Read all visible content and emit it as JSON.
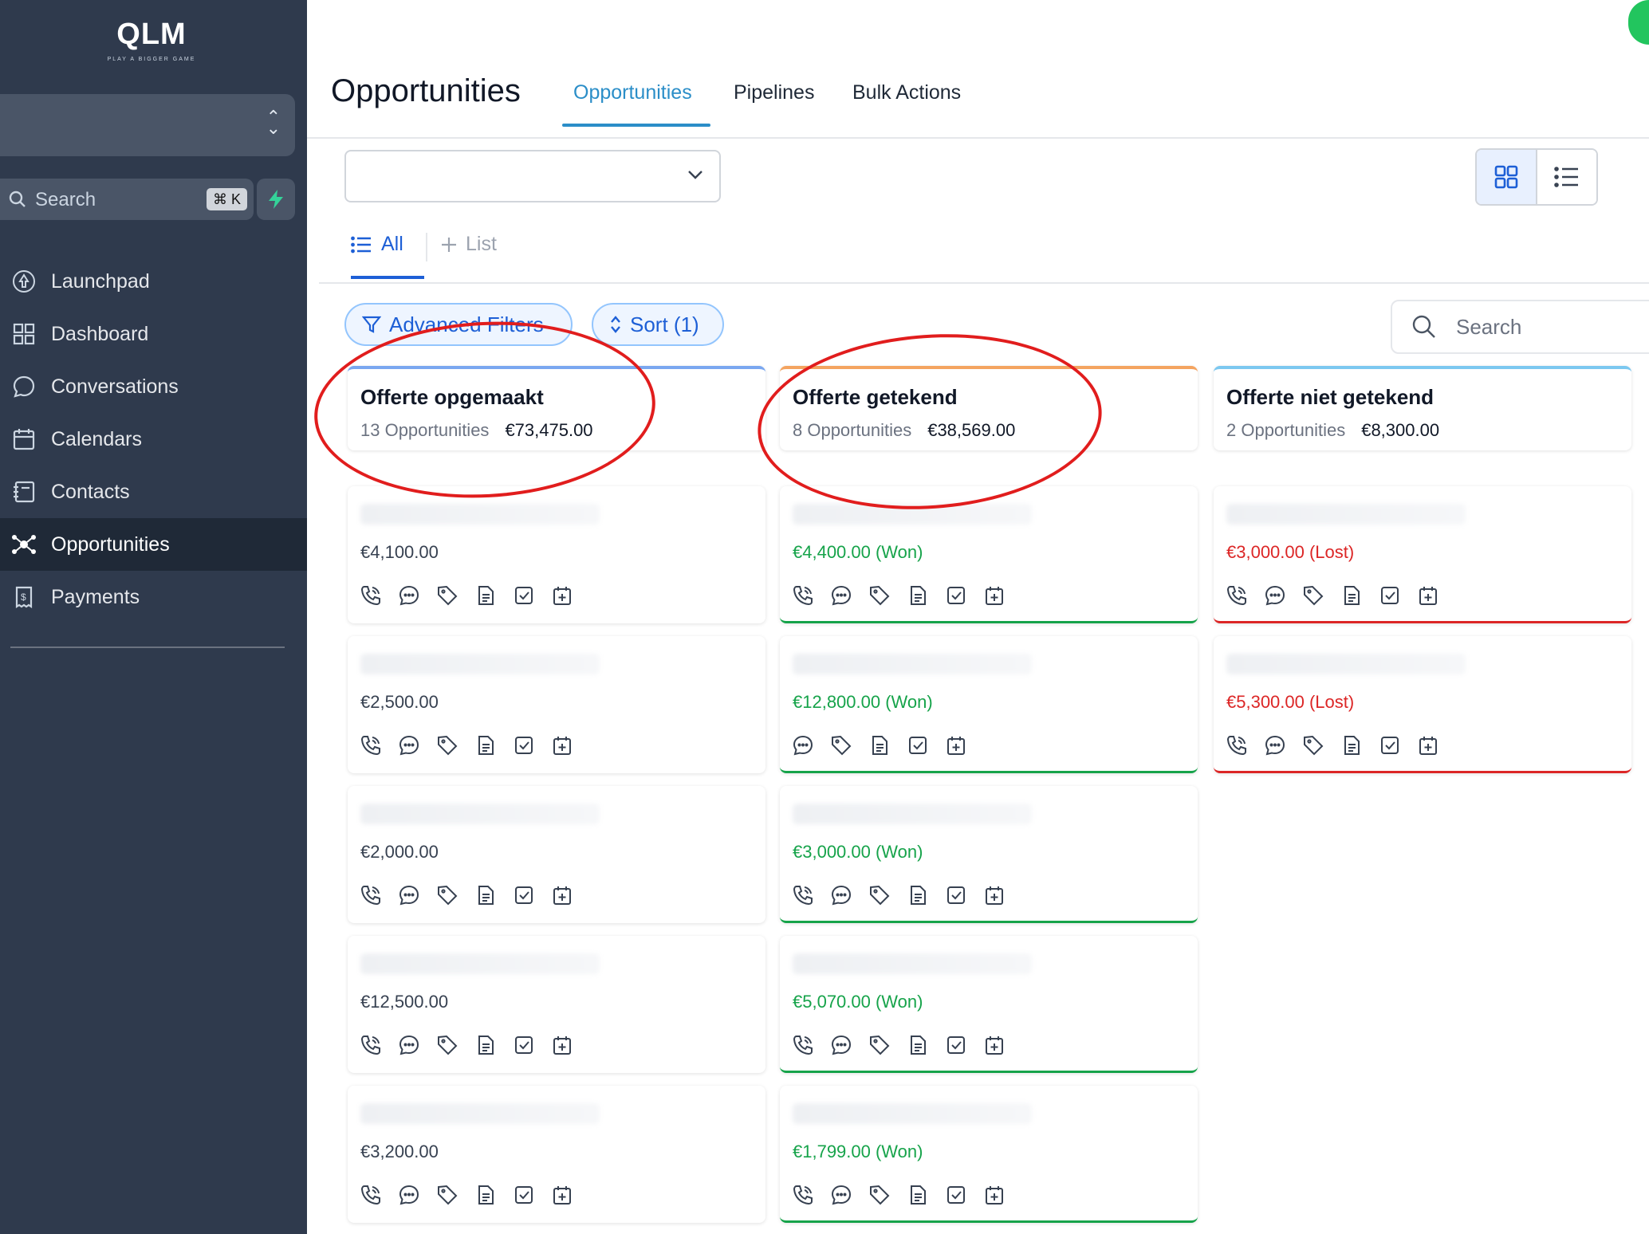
{
  "sidebar": {
    "logo_text": "QLM",
    "logo_tagline": "PLAY A BIGGER GAME",
    "search_placeholder": "Search",
    "search_shortcut": "⌘ K",
    "nav": [
      {
        "label": "Launchpad",
        "icon": "rocket-icon"
      },
      {
        "label": "Dashboard",
        "icon": "dashboard-grid-icon"
      },
      {
        "label": "Conversations",
        "icon": "chat-bubble-icon"
      },
      {
        "label": "Calendars",
        "icon": "calendar-icon"
      },
      {
        "label": "Contacts",
        "icon": "contacts-book-icon"
      },
      {
        "label": "Opportunities",
        "icon": "opportunities-icon",
        "active": true
      },
      {
        "label": "Payments",
        "icon": "payments-icon"
      }
    ]
  },
  "header": {
    "title": "Opportunities",
    "tabs": [
      {
        "label": "Opportunities",
        "active": true
      },
      {
        "label": "Pipelines"
      },
      {
        "label": "Bulk Actions"
      }
    ]
  },
  "toolbar": {
    "pipeline_value": "",
    "subtab_all": "All",
    "subtab_add_list": "List",
    "advanced_filters": "Advanced Filters",
    "sort": "Sort (1)",
    "search_placeholder": "Search"
  },
  "colors": {
    "accent": "#2b8ec8",
    "won": "#16a34a",
    "lost": "#dc2626",
    "annotation": "#e11d1d"
  },
  "board": {
    "columns": [
      {
        "name": "Offerte opgemaakt",
        "count": "13 Opportunities",
        "total": "€73,475.00",
        "accent": "#7aa7f0",
        "cards": [
          {
            "value": "€4,100.00",
            "status": "open"
          },
          {
            "value": "€2,500.00",
            "status": "open"
          },
          {
            "value": "€2,000.00",
            "status": "open"
          },
          {
            "value": "€12,500.00",
            "status": "open"
          },
          {
            "value": "€3,200.00",
            "status": "open"
          }
        ]
      },
      {
        "name": "Offerte getekend",
        "count": "8 Opportunities",
        "total": "€38,569.00",
        "accent": "#f4a460",
        "cards": [
          {
            "value": "€4,400.00 (Won)",
            "status": "won"
          },
          {
            "value": "€12,800.00 (Won)",
            "status": "won"
          },
          {
            "value": "€3,000.00 (Won)",
            "status": "won"
          },
          {
            "value": "€5,070.00 (Won)",
            "status": "won"
          },
          {
            "value": "€1,799.00 (Won)",
            "status": "won"
          }
        ]
      },
      {
        "name": "Offerte niet getekend",
        "count": "2 Opportunities",
        "total": "€8,300.00",
        "accent": "#7cc8f0",
        "cards": [
          {
            "value": "€3,000.00 (Lost)",
            "status": "lost"
          },
          {
            "value": "€5,300.00 (Lost)",
            "status": "lost"
          }
        ]
      }
    ]
  }
}
